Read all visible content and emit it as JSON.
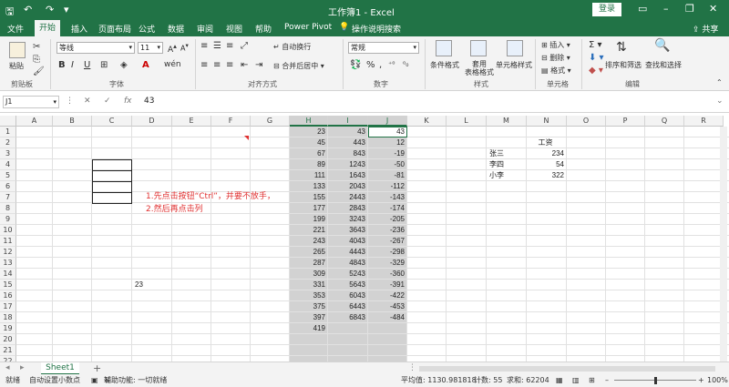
{
  "window": {
    "title": "工作簿1 - Excel",
    "login": "登录",
    "share": "共享"
  },
  "tabs": [
    "文件",
    "开始",
    "插入",
    "页面布局",
    "公式",
    "数据",
    "审阅",
    "视图",
    "帮助",
    "Power Pivot",
    "操作说明搜索"
  ],
  "ribbon": {
    "clipboard": {
      "paste": "粘贴",
      "label": "剪贴板"
    },
    "font": {
      "name": "等线",
      "size": "11",
      "label": "字体"
    },
    "alignment": {
      "wrap": "自动换行",
      "merge": "合并后居中",
      "label": "对齐方式"
    },
    "number": {
      "format": "常规",
      "label": "数字"
    },
    "styles": {
      "cond": "条件格式",
      "table": "套用\n表格格式",
      "cell": "单元格样式",
      "label": "样式"
    },
    "cells": {
      "insert": "插入",
      "delete": "删除",
      "format": "格式",
      "label": "单元格"
    },
    "editing": {
      "sort": "排序和筛选",
      "find": "查找和选择",
      "label": "编辑"
    }
  },
  "formula_bar": {
    "name_box": "J1",
    "fx": "fx",
    "value": "43"
  },
  "columns": [
    "A",
    "B",
    "C",
    "D",
    "E",
    "F",
    "G",
    "H",
    "I",
    "J",
    "K",
    "L",
    "M",
    "N",
    "O",
    "P",
    "Q",
    "R"
  ],
  "rows": [
    "1",
    "2",
    "3",
    "4",
    "5",
    "6",
    "7",
    "8",
    "9",
    "10",
    "11",
    "12",
    "13",
    "14",
    "15",
    "16",
    "17",
    "18",
    "19",
    "20",
    "21",
    "22"
  ],
  "col_h": [
    "23",
    "45",
    "67",
    "89",
    "111",
    "133",
    "155",
    "177",
    "199",
    "221",
    "243",
    "265",
    "287",
    "309",
    "331",
    "353",
    "375",
    "397",
    "419"
  ],
  "col_i": [
    "43",
    "443",
    "843",
    "1243",
    "1643",
    "2043",
    "2443",
    "2843",
    "3243",
    "3643",
    "4043",
    "4443",
    "4843",
    "5243",
    "5643",
    "6043",
    "6443",
    "6843"
  ],
  "col_j": [
    "43",
    "12",
    "-19",
    "-50",
    "-81",
    "-112",
    "-143",
    "-174",
    "-205",
    "-236",
    "-267",
    "-298",
    "-329",
    "-360",
    "-391",
    "-422",
    "-453",
    "-484"
  ],
  "d15": "23",
  "salary": {
    "header": "工资",
    "rows": [
      {
        "name": "张三",
        "value": "234"
      },
      {
        "name": "李四",
        "value": "54"
      },
      {
        "name": "小李",
        "value": "322"
      }
    ]
  },
  "note": {
    "line1": "1.先点击按钮“Ctrl”，并要不放手，",
    "line2": "2.然后再点击列"
  },
  "sheet": {
    "name": "Sheet1",
    "add": "+"
  },
  "status": {
    "ready": "就绪",
    "decimal": "自动设置小数点",
    "accessibility": "辅助功能: 一切就绪",
    "average": "平均值: 1130.981818",
    "count": "计数: 55",
    "sum": "求和: 62204",
    "zoom": "100%"
  }
}
